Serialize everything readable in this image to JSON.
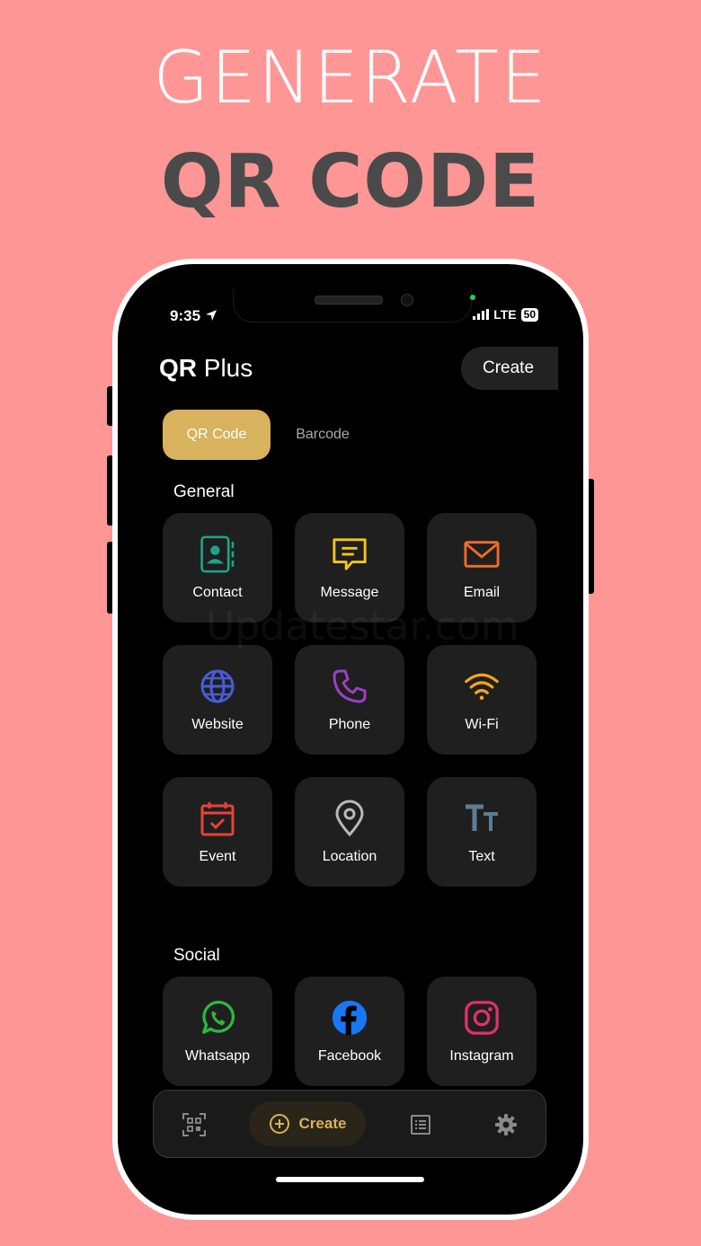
{
  "headline": {
    "line1": "GENERATE",
    "line2": "QR CODE"
  },
  "status_bar": {
    "time": "9:35",
    "network": "LTE",
    "battery": "50"
  },
  "app": {
    "title_bold": "QR",
    "title_rest": " Plus",
    "create_button": "Create"
  },
  "tabs": {
    "active": "QR Code",
    "inactive": "Barcode"
  },
  "sections": {
    "general": {
      "label": "General",
      "items": [
        {
          "label": "Contact",
          "icon": "contact-book-icon",
          "color": "#1FA38A"
        },
        {
          "label": "Message",
          "icon": "message-bubble-icon",
          "color": "#F5C518"
        },
        {
          "label": "Email",
          "icon": "envelope-icon",
          "color": "#F26B2B"
        },
        {
          "label": "Website",
          "icon": "globe-icon",
          "color": "#4A5BD6"
        },
        {
          "label": "Phone",
          "icon": "phone-icon",
          "color": "#9B3FC4"
        },
        {
          "label": "Wi-Fi",
          "icon": "wifi-icon",
          "color": "#F5A51A"
        },
        {
          "label": "Event",
          "icon": "calendar-icon",
          "color": "#E8413A"
        },
        {
          "label": "Location",
          "icon": "map-pin-icon",
          "color": "#B8B8B8"
        },
        {
          "label": "Text",
          "icon": "text-size-icon",
          "color": "#5A7E96"
        }
      ]
    },
    "social": {
      "label": "Social",
      "items": [
        {
          "label": "Whatsapp",
          "icon": "whatsapp-icon",
          "color": "#2DB742"
        },
        {
          "label": "Facebook",
          "icon": "facebook-icon",
          "color": "#1877F2"
        },
        {
          "label": "Instagram",
          "icon": "instagram-icon",
          "color": "#E1306C"
        }
      ]
    }
  },
  "watermark": "Updatestar.com",
  "bottom_nav": {
    "create_label": "Create"
  },
  "colors": {
    "background": "#FF9696",
    "accent": "#D8B25C",
    "tile": "#1f1f1f"
  }
}
